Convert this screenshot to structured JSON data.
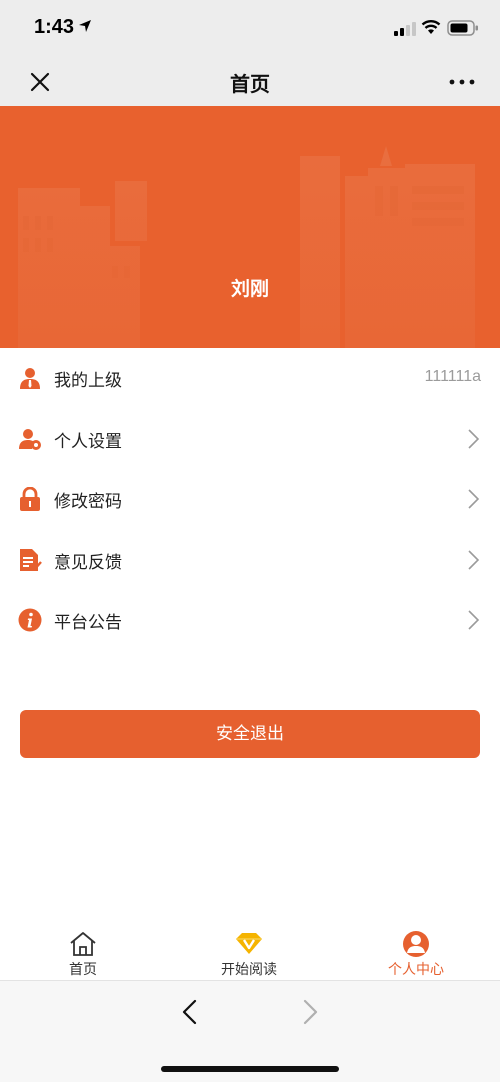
{
  "status_bar": {
    "time": "1:43"
  },
  "nav": {
    "title": "首页"
  },
  "profile": {
    "name": "刘刚"
  },
  "menu": {
    "items": [
      {
        "label": "我的上级",
        "value": "111111a",
        "icon": "supervisor-icon"
      },
      {
        "label": "个人设置",
        "value": "",
        "icon": "user-settings-icon"
      },
      {
        "label": "修改密码",
        "value": "",
        "icon": "lock-icon"
      },
      {
        "label": "意见反馈",
        "value": "",
        "icon": "feedback-icon"
      },
      {
        "label": "平台公告",
        "value": "",
        "icon": "info-icon"
      }
    ]
  },
  "logout": {
    "label": "安全退出"
  },
  "tabs": [
    {
      "label": "首页",
      "icon": "home-icon",
      "active": false
    },
    {
      "label": "开始阅读",
      "icon": "vip-diamond-icon",
      "active": false
    },
    {
      "label": "个人中心",
      "icon": "user-center-icon",
      "active": true
    }
  ],
  "colors": {
    "accent": "#e6602f",
    "banner": "#e8612e",
    "icon": "#e6602f",
    "vip_gold": "#f5b400"
  }
}
